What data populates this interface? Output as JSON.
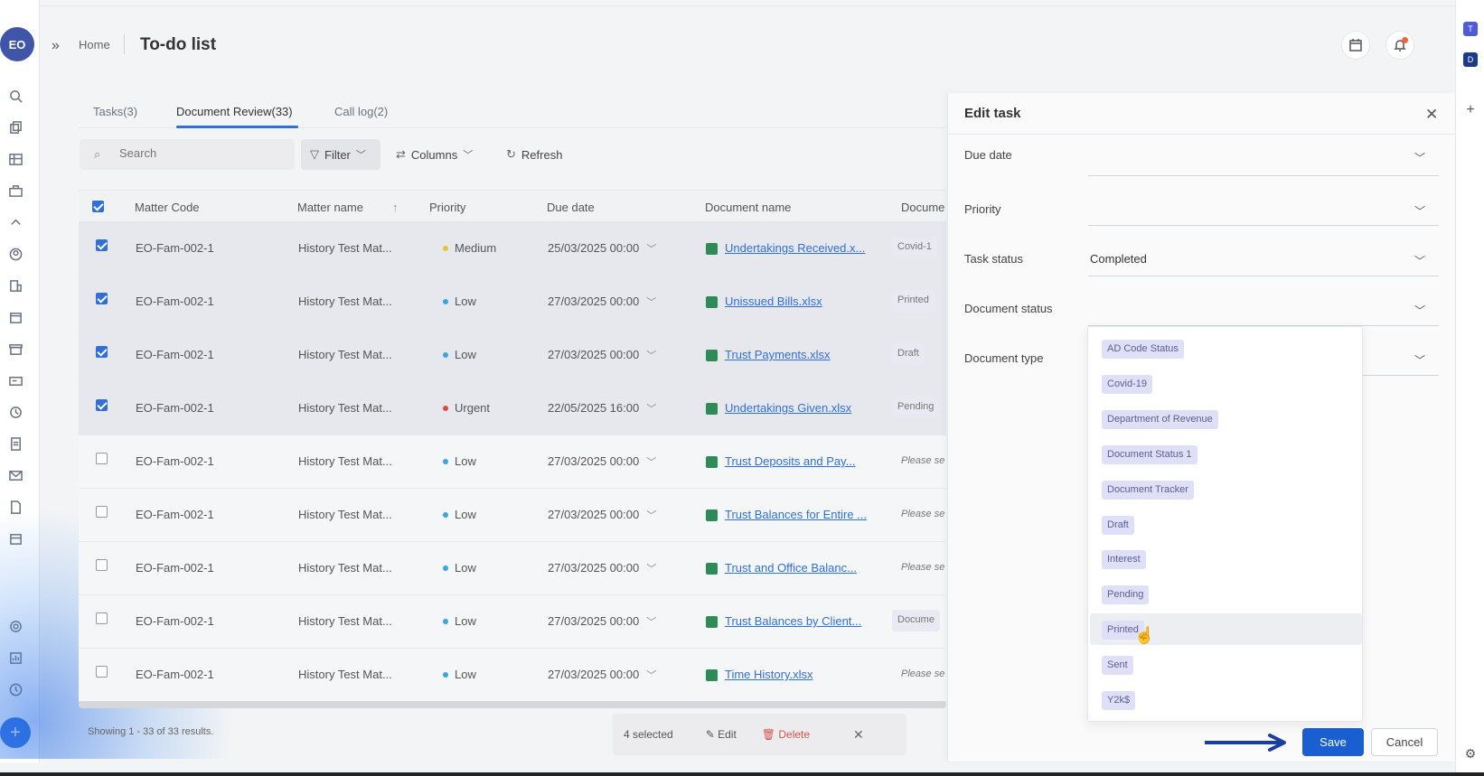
{
  "user": {
    "initials": "EO"
  },
  "breadcrumb": {
    "home": "Home",
    "title": "To-do list"
  },
  "tabs": [
    {
      "label": "Tasks(3)",
      "active": false
    },
    {
      "label": "Document Review(33)",
      "active": true
    },
    {
      "label": "Call log(2)",
      "active": false
    }
  ],
  "toolbar": {
    "search_placeholder": "Search",
    "filter_label": "Filter",
    "columns_label": "Columns",
    "refresh_label": "Refresh"
  },
  "table": {
    "headers": [
      "Matter Code",
      "Matter name",
      "Priority",
      "Due date",
      "Document name",
      "Docume"
    ],
    "rows": [
      {
        "checked": true,
        "code": "EO-Fam-002-1",
        "matter": "History Test Mat...",
        "priority": "Medium",
        "priority_color": "#e5c53d",
        "due": "25/03/2025 00:00",
        "doc": "Undertakings Received.x...",
        "status": "Covid-1",
        "status_tag": true
      },
      {
        "checked": true,
        "code": "EO-Fam-002-1",
        "matter": "History Test Mat...",
        "priority": "Low",
        "priority_color": "#3aa6e0",
        "due": "27/03/2025 00:00",
        "doc": "Unissued Bills.xlsx",
        "status": "Printed",
        "status_tag": true
      },
      {
        "checked": true,
        "code": "EO-Fam-002-1",
        "matter": "History Test Mat...",
        "priority": "Low",
        "priority_color": "#3aa6e0",
        "due": "27/03/2025 00:00",
        "doc": "Trust Payments.xlsx",
        "status": "Draft",
        "status_tag": true
      },
      {
        "checked": true,
        "code": "EO-Fam-002-1",
        "matter": "History Test Mat...",
        "priority": "Urgent",
        "priority_color": "#e04a3a",
        "due": "22/05/2025 16:00",
        "doc": "Undertakings Given.xlsx",
        "status": "Pending",
        "status_tag": true
      },
      {
        "checked": false,
        "code": "EO-Fam-002-1",
        "matter": "History Test Mat...",
        "priority": "Low",
        "priority_color": "#3aa6e0",
        "due": "27/03/2025 00:00",
        "doc": "Trust Deposits and Pay...",
        "status": "Please se",
        "status_tag": false
      },
      {
        "checked": false,
        "code": "EO-Fam-002-1",
        "matter": "History Test Mat...",
        "priority": "Low",
        "priority_color": "#3aa6e0",
        "due": "27/03/2025 00:00",
        "doc": "Trust Balances for Entire ...",
        "status": "Please se",
        "status_tag": false
      },
      {
        "checked": false,
        "code": "EO-Fam-002-1",
        "matter": "History Test Mat...",
        "priority": "Low",
        "priority_color": "#3aa6e0",
        "due": "27/03/2025 00:00",
        "doc": "Trust and Office Balanc...",
        "status": "Please se",
        "status_tag": false
      },
      {
        "checked": false,
        "code": "EO-Fam-002-1",
        "matter": "History Test Mat...",
        "priority": "Low",
        "priority_color": "#3aa6e0",
        "due": "27/03/2025 00:00",
        "doc": "Trust Balances by Client...",
        "status": "Docume",
        "status_tag": true
      },
      {
        "checked": false,
        "code": "EO-Fam-002-1",
        "matter": "History Test Mat...",
        "priority": "Low",
        "priority_color": "#3aa6e0",
        "due": "27/03/2025 00:00",
        "doc": "Time History.xlsx",
        "status": "Please se",
        "status_tag": false
      }
    ]
  },
  "footer": {
    "showing": "Showing 1 - 33 of 33 results."
  },
  "selection_bar": {
    "count": "4 selected",
    "edit": "Edit",
    "delete": "Delete"
  },
  "edit_panel": {
    "title": "Edit task",
    "fields": {
      "due_date": "Due date",
      "priority": "Priority",
      "task_status": "Task status",
      "task_status_value": "Completed",
      "document_status": "Document status",
      "document_type": "Document type"
    },
    "save": "Save",
    "cancel": "Cancel"
  },
  "dropdown_options": [
    "AD Code Status",
    "Covid-19",
    "Department of Revenue",
    "Document Status 1",
    "Document Tracker",
    "Draft",
    "Interest",
    "Pending",
    "Printed",
    "Sent",
    "Y2k$"
  ],
  "dropdown_hover": "Printed",
  "colors": {
    "accent": "#2f6fdc",
    "save": "#1a5fd1"
  }
}
